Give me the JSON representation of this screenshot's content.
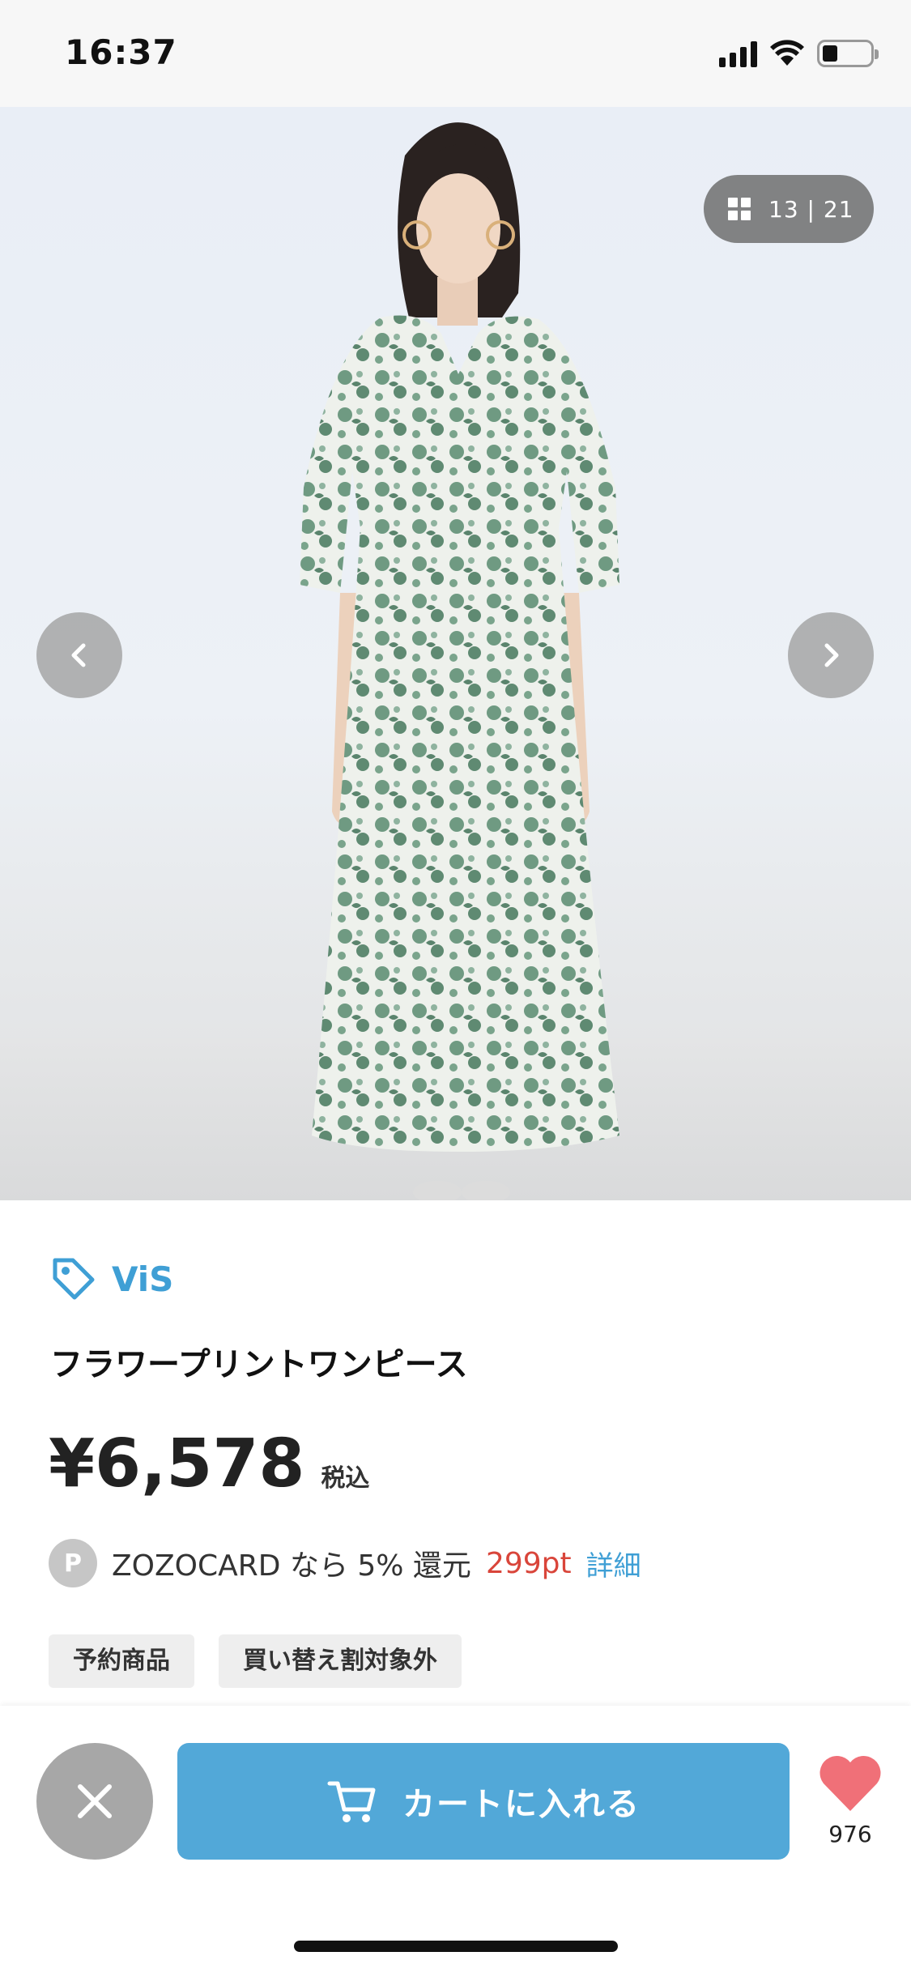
{
  "status_bar": {
    "time": "16:37"
  },
  "gallery": {
    "current": "13",
    "separator": "|",
    "total": "21"
  },
  "product": {
    "brand": "ViS",
    "name": "フラワープリントワンピース",
    "price": "¥6,578",
    "tax_label": "税込"
  },
  "points": {
    "badge": "P",
    "text": "ZOZOCARD なら 5% 還元",
    "value": "299pt",
    "detail": "詳細"
  },
  "tags": [
    "予約商品",
    "買い替え割対象外"
  ],
  "actions": {
    "cart_label": "カートに入れる",
    "like_count": "976"
  },
  "colors": {
    "accent_blue": "#52a8d8",
    "brand_blue": "#3f9fd5",
    "points_red": "#d9453a",
    "like_heart": "#f07078"
  }
}
